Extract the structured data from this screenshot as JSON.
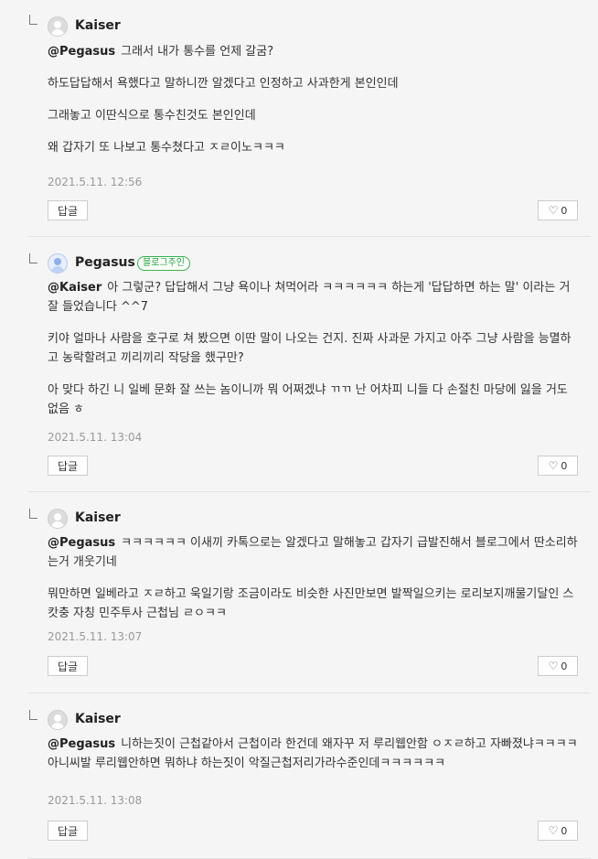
{
  "comments": [
    {
      "author": "Kaiser",
      "badge": "",
      "mention": "@Pegasus",
      "lines": [
        "그래서 내가 통수를 언제 갈굼?",
        "하도답답해서 욕했다고 말하니깐 알겠다고 인정하고 사과한게 본인인데",
        "그래놓고 이딴식으로 통수친것도 본인인데",
        "왜 갑자기 또 나보고 통수쳤다고 ㅈㄹ이노ㅋㅋㅋ"
      ],
      "date": "2021.5.11. 12:56",
      "reply_label": "답글",
      "likes": "0"
    },
    {
      "author": "Pegasus",
      "badge": "블로그주인",
      "mention": "@Kaiser",
      "lines": [
        "아 그렇군? 답답해서 그냥 욕이나 쳐먹어라 ㅋㅋㅋㅋㅋㅋ 하는게 '답답하면 하는 말' 이라는 거 잘 들었습니다 ^^7",
        "키야 얼마나 사람을 호구로 쳐 봤으면 이딴 말이 나오는 건지. 진짜 사과문 가지고 아주 그냥 사람을 능멸하고 농락할려고 끼리끼리 작당을 했구만?",
        "아 맞다 하긴 니 일베 문화 잘 쓰는 놈이니까 뭐 어쩌겠냐 ㄲㄲ 난 어차피 니들 다 손절친 마당에 잃을 거도 없음 ㅎ"
      ],
      "date": "2021.5.11. 13:04",
      "reply_label": "답글",
      "likes": "0"
    },
    {
      "author": "Kaiser",
      "badge": "",
      "mention": "@Pegasus",
      "lines": [
        "ㅋㅋㅋㅋㅋㅋ 이새끼 카톡으로는 알겠다고 말해놓고 갑자기 급발진해서 블로그에서 딴소리하는거 개웃기네",
        "뭐만하면 일베라고 ㅈㄹ하고 욱일기랑 조금이라도 비슷한 사진만보면 발짝일으키는 로리보지깨물기달인 스캇충 자칭 민주투사 근첩님 ㄹㅇㅋㅋ"
      ],
      "date": "2021.5.11. 13:07",
      "reply_label": "답글",
      "likes": "0"
    },
    {
      "author": "Kaiser",
      "badge": "",
      "mention": "@Pegasus",
      "lines": [
        "니하는짓이 근첩같아서 근첩이라 한건데 왜자꾸 저 루리웹안함 ㅇㅈㄹ하고 자빠졌냐ㅋㅋㅋㅋ",
        "아니씨발 루리웹안하면 뭐하냐 하는짓이 악질근첩저리가라수준인데ㅋㅋㅋㅋㅋㅋ"
      ],
      "date": "2021.5.11. 13:08",
      "reply_label": "답글",
      "likes": "0"
    }
  ]
}
